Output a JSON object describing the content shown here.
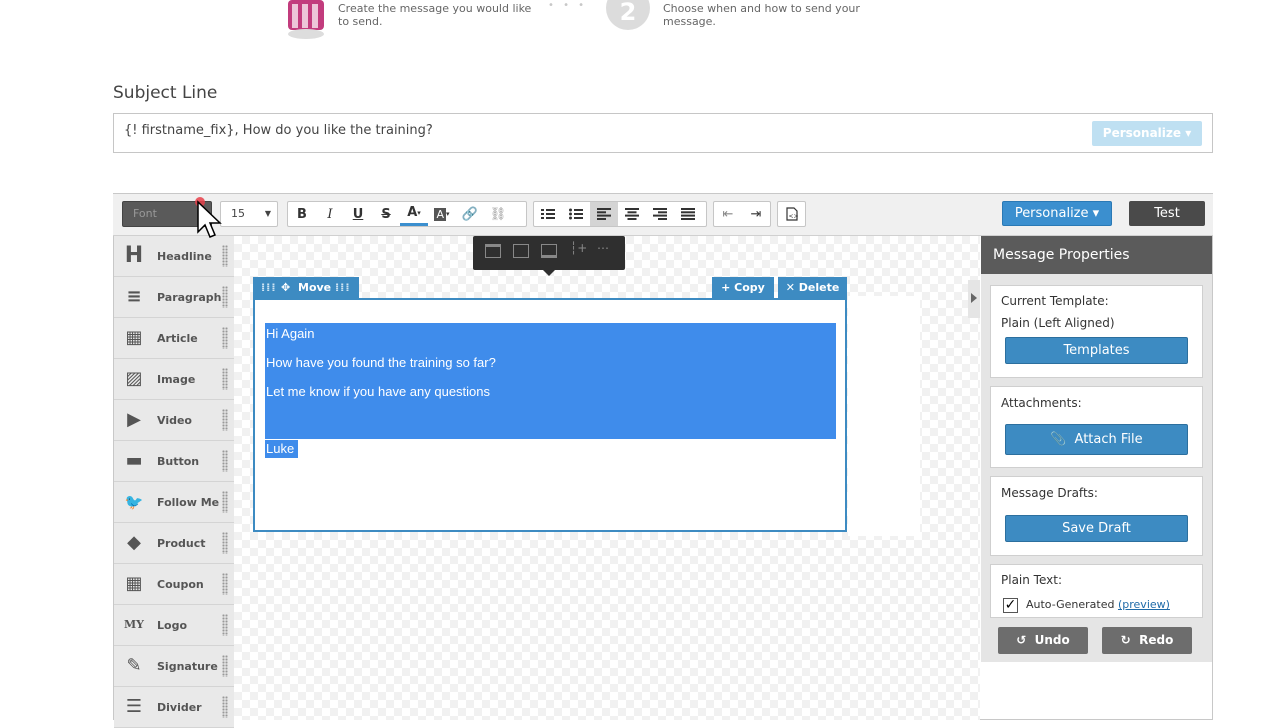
{
  "steps": {
    "step1_text": "Create the message you would like to send.",
    "step2_number": "2",
    "step2_text": "Choose when and how to send your message."
  },
  "subject": {
    "label": "Subject Line",
    "value": "{! firstname_fix}, How do you like the training?",
    "personalize_label": "Personalize ▾"
  },
  "toolbar": {
    "font_label": "Font",
    "size_value": "15",
    "personalize_label": "Personalize ▾",
    "test_label": "Test"
  },
  "sidebar": {
    "items": [
      {
        "label": "Headline",
        "icon": "H"
      },
      {
        "label": "Paragraph",
        "icon": "≡"
      },
      {
        "label": "Article",
        "icon": "▦"
      },
      {
        "label": "Image",
        "icon": "▨"
      },
      {
        "label": "Video",
        "icon": "▶"
      },
      {
        "label": "Button",
        "icon": "▬"
      },
      {
        "label": "Follow Me",
        "icon": "🐦"
      },
      {
        "label": "Product",
        "icon": "◆"
      },
      {
        "label": "Coupon",
        "icon": "▦"
      },
      {
        "label": "Logo",
        "icon": "MY"
      },
      {
        "label": "Signature",
        "icon": "✎"
      },
      {
        "label": "Divider",
        "icon": "☰"
      }
    ]
  },
  "block": {
    "move_label": "Move",
    "copy_label": "+ Copy",
    "delete_label": "✕ Delete",
    "lines": [
      "Hi Again",
      "How have you found the training so far?",
      "Let me know if you have any questions"
    ],
    "signoff": "Luke"
  },
  "properties": {
    "title": "Message Properties",
    "template_label": "Current Template:",
    "template_value": "Plain (Left Aligned)",
    "templates_button": "Templates",
    "attachments_label": "Attachments:",
    "attach_button": "Attach File",
    "drafts_label": "Message Drafts:",
    "save_draft_button": "Save Draft",
    "plain_text_label": "Plain Text:",
    "auto_generated": "Auto-Generated",
    "preview_link": "(preview)",
    "undo_label": "Undo",
    "redo_label": "Redo"
  },
  "colors": {
    "accent": "#3d8bc2",
    "selection": "#3f8ceb",
    "dark_button": "#4a4a4a"
  }
}
